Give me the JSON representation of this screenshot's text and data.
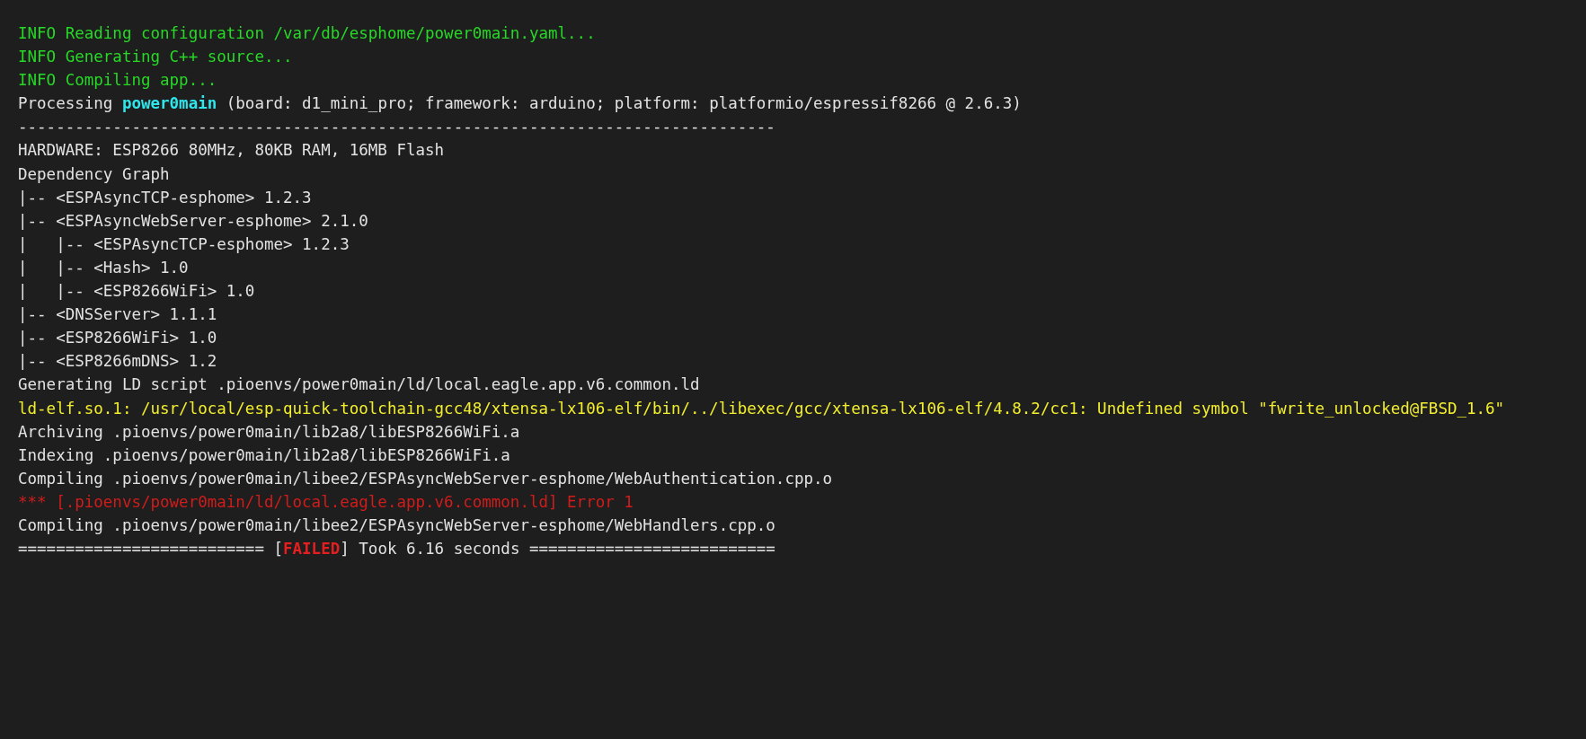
{
  "log_lines": [
    {
      "segments": [
        {
          "text": "INFO Reading configuration /var/db/esphome/power0main.yaml...",
          "kind": "info"
        }
      ]
    },
    {
      "segments": [
        {
          "text": "INFO Generating C++ source...",
          "kind": "info"
        }
      ]
    },
    {
      "segments": [
        {
          "text": "INFO Compiling app...",
          "kind": "info"
        }
      ]
    },
    {
      "segments": [
        {
          "text": "Processing ",
          "kind": "plain"
        },
        {
          "text": "power0main",
          "kind": "highlight"
        },
        {
          "text": " (board: d1_mini_pro; framework: arduino; platform: platformio/espressif8266 @ 2.6.3)",
          "kind": "plain"
        }
      ]
    },
    {
      "segments": [
        {
          "text": "--------------------------------------------------------------------------------",
          "kind": "plain"
        }
      ]
    },
    {
      "segments": [
        {
          "text": "HARDWARE: ESP8266 80MHz, 80KB RAM, 16MB Flash",
          "kind": "plain"
        }
      ]
    },
    {
      "segments": [
        {
          "text": "Dependency Graph",
          "kind": "plain"
        }
      ]
    },
    {
      "segments": [
        {
          "text": "|-- <ESPAsyncTCP-esphome> 1.2.3",
          "kind": "plain"
        }
      ]
    },
    {
      "segments": [
        {
          "text": "|-- <ESPAsyncWebServer-esphome> 2.1.0",
          "kind": "plain"
        }
      ]
    },
    {
      "segments": [
        {
          "text": "|   |-- <ESPAsyncTCP-esphome> 1.2.3",
          "kind": "plain"
        }
      ]
    },
    {
      "segments": [
        {
          "text": "|   |-- <Hash> 1.0",
          "kind": "plain"
        }
      ]
    },
    {
      "segments": [
        {
          "text": "|   |-- <ESP8266WiFi> 1.0",
          "kind": "plain"
        }
      ]
    },
    {
      "segments": [
        {
          "text": "|-- <DNSServer> 1.1.1",
          "kind": "plain"
        }
      ]
    },
    {
      "segments": [
        {
          "text": "|-- <ESP8266WiFi> 1.0",
          "kind": "plain"
        }
      ]
    },
    {
      "segments": [
        {
          "text": "|-- <ESP8266mDNS> 1.2",
          "kind": "plain"
        }
      ]
    },
    {
      "segments": [
        {
          "text": "Generating LD script .pioenvs/power0main/ld/local.eagle.app.v6.common.ld",
          "kind": "plain"
        }
      ]
    },
    {
      "segments": [
        {
          "text": "ld-elf.so.1: /usr/local/esp-quick-toolchain-gcc48/xtensa-lx106-elf/bin/../libexec/gcc/xtensa-lx106-elf/4.8.2/cc1: Undefined symbol \"fwrite_unlocked@FBSD_1.6\"",
          "kind": "warning"
        }
      ]
    },
    {
      "segments": [
        {
          "text": "Archiving .pioenvs/power0main/lib2a8/libESP8266WiFi.a",
          "kind": "plain"
        }
      ]
    },
    {
      "segments": [
        {
          "text": "Indexing .pioenvs/power0main/lib2a8/libESP8266WiFi.a",
          "kind": "plain"
        }
      ]
    },
    {
      "segments": [
        {
          "text": "Compiling .pioenvs/power0main/libee2/ESPAsyncWebServer-esphome/WebAuthentication.cpp.o",
          "kind": "plain"
        }
      ]
    },
    {
      "segments": [
        {
          "text": "*** [.pioenvs/power0main/ld/local.eagle.app.v6.common.ld] Error 1",
          "kind": "error"
        }
      ]
    },
    {
      "segments": [
        {
          "text": "Compiling .pioenvs/power0main/libee2/ESPAsyncWebServer-esphome/WebHandlers.cpp.o",
          "kind": "plain"
        }
      ]
    },
    {
      "segments": [
        {
          "text": "========================== [",
          "kind": "plain"
        },
        {
          "text": "FAILED",
          "kind": "failure"
        },
        {
          "text": "] Took 6.16 seconds ==========================",
          "kind": "plain"
        }
      ]
    }
  ]
}
